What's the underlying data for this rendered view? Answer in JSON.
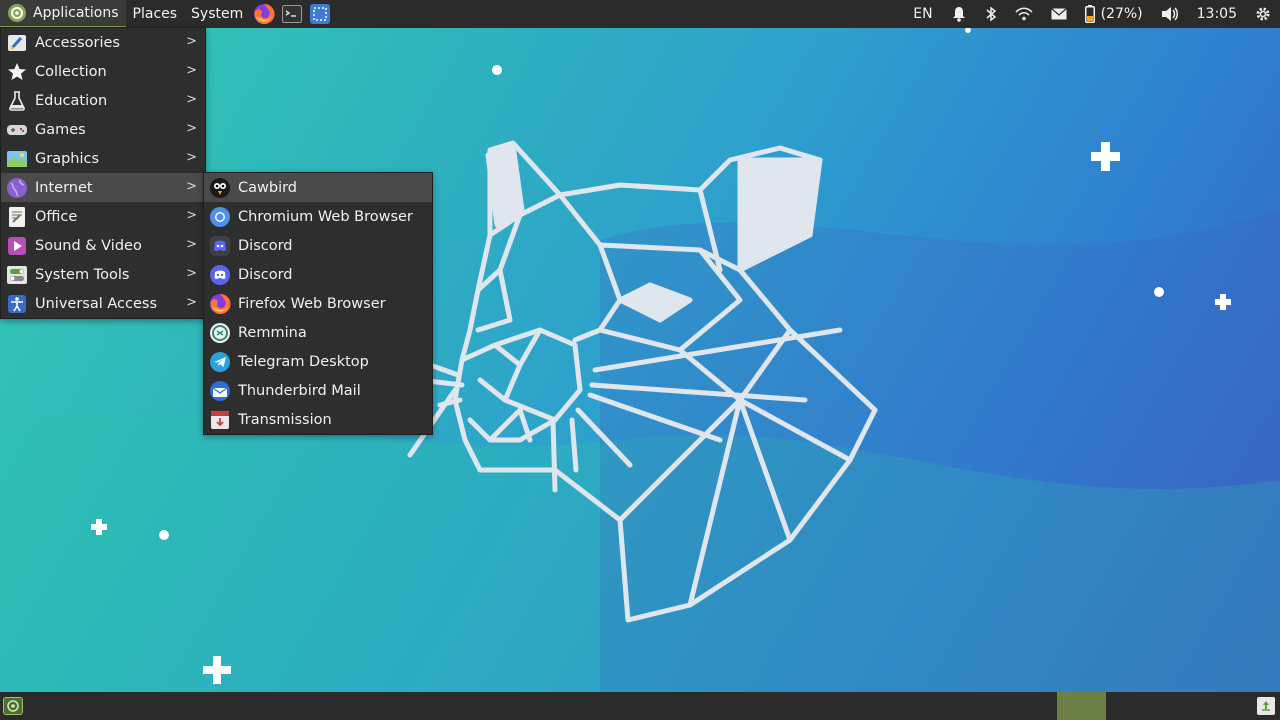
{
  "top_panel": {
    "menus": [
      "Applications",
      "Places",
      "System"
    ],
    "keyboard_layout": "EN",
    "battery_text": "(27%)",
    "clock": "13:05"
  },
  "apps_menu": {
    "items": [
      {
        "label": "Accessories",
        "icon": "accessories-icon"
      },
      {
        "label": "Collection",
        "icon": "star-icon"
      },
      {
        "label": "Education",
        "icon": "flask-icon"
      },
      {
        "label": "Games",
        "icon": "gamepad-icon"
      },
      {
        "label": "Graphics",
        "icon": "graphics-icon"
      },
      {
        "label": "Internet",
        "icon": "globe-icon"
      },
      {
        "label": "Office",
        "icon": "office-icon"
      },
      {
        "label": "Sound & Video",
        "icon": "media-icon"
      },
      {
        "label": "System Tools",
        "icon": "toggles-icon"
      },
      {
        "label": "Universal Access",
        "icon": "accessibility-icon"
      }
    ],
    "arrow": ">"
  },
  "internet_submenu": {
    "items": [
      {
        "label": "Cawbird",
        "icon": "cawbird-icon"
      },
      {
        "label": "Chromium Web Browser",
        "icon": "chromium-icon"
      },
      {
        "label": "Discord",
        "icon": "discord-icon"
      },
      {
        "label": "Discord",
        "icon": "discord-icon"
      },
      {
        "label": "Firefox Web Browser",
        "icon": "firefox-icon"
      },
      {
        "label": "Remmina",
        "icon": "remmina-icon"
      },
      {
        "label": "Telegram Desktop",
        "icon": "telegram-icon"
      },
      {
        "label": "Thunderbird Mail",
        "icon": "thunderbird-icon"
      },
      {
        "label": "Transmission",
        "icon": "transmission-icon"
      }
    ]
  },
  "colors": {
    "panel": "#2b2b2b",
    "menu_bg": "#2e2e2e",
    "accent": "#87a556",
    "wallpaper_start": "#34c9b2",
    "wallpaper_end": "#3a5cbf"
  }
}
